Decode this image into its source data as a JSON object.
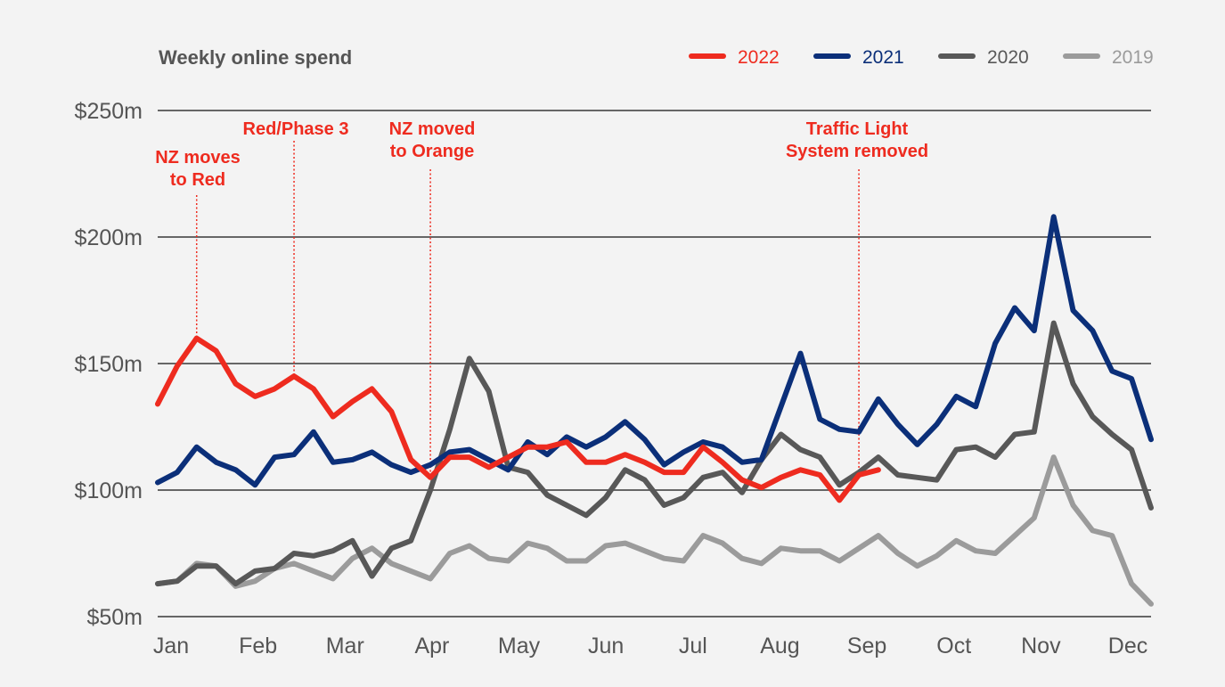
{
  "chart_data": {
    "type": "line",
    "title": "Weekly online spend",
    "xlabel": "",
    "ylabel": "",
    "ylim": [
      50,
      250
    ],
    "yticks": [
      250,
      200,
      150,
      100,
      50
    ],
    "ytick_labels": [
      "$250m",
      "$200m",
      "$150m",
      "$100m",
      "$50m"
    ],
    "grid": true,
    "x_weeks": 52,
    "x_tick_labels": [
      "Jan",
      "Feb",
      "Mar",
      "Apr",
      "May",
      "Jun",
      "Jul",
      "Aug",
      "Sep",
      "Oct",
      "Nov",
      "Dec"
    ],
    "legend_position": "top-right",
    "series": [
      {
        "name": "2019",
        "color": "#9b9b9b",
        "values": [
          63,
          64,
          71,
          70,
          62,
          64,
          69,
          71,
          68,
          65,
          73,
          77,
          71,
          68,
          65,
          75,
          78,
          73,
          72,
          79,
          77,
          72,
          72,
          78,
          79,
          76,
          73,
          72,
          82,
          79,
          73,
          71,
          77,
          76,
          76,
          72,
          77,
          82,
          75,
          70,
          74,
          80,
          76,
          75,
          82,
          89,
          113,
          94,
          84,
          82,
          63,
          55
        ]
      },
      {
        "name": "2020",
        "color": "#585858",
        "values": [
          63,
          64,
          70,
          70,
          63,
          68,
          69,
          75,
          74,
          76,
          80,
          66,
          77,
          80,
          100,
          124,
          152,
          139,
          109,
          107,
          98,
          94,
          90,
          97,
          108,
          104,
          94,
          97,
          105,
          107,
          99,
          112,
          122,
          116,
          113,
          102,
          107,
          113,
          106,
          105,
          104,
          116,
          117,
          113,
          122,
          123,
          166,
          142,
          129,
          122,
          116,
          93
        ]
      },
      {
        "name": "2021",
        "color": "#0b2f79",
        "values": [
          103,
          107,
          117,
          111,
          108,
          102,
          113,
          114,
          123,
          111,
          112,
          115,
          110,
          107,
          110,
          115,
          116,
          112,
          108,
          119,
          114,
          121,
          117,
          121,
          127,
          120,
          110,
          115,
          119,
          117,
          111,
          112,
          133,
          154,
          128,
          124,
          123,
          136,
          126,
          118,
          126,
          137,
          133,
          158,
          172,
          163,
          208,
          171,
          163,
          147,
          144,
          120
        ]
      },
      {
        "name": "2022",
        "color": "#ee2b1f",
        "values": [
          134,
          149,
          160,
          155,
          142,
          137,
          140,
          145,
          140,
          129,
          135,
          140,
          131,
          112,
          105,
          113,
          113,
          109,
          113,
          117,
          117,
          119,
          111,
          111,
          114,
          111,
          107,
          107,
          117,
          111,
          104,
          101,
          105,
          108,
          106,
          96,
          106,
          108
        ]
      }
    ],
    "annotations": [
      {
        "lines": [
          "NZ moves",
          "to Red"
        ],
        "week": 2
      },
      {
        "lines": [
          "Red/Phase 3"
        ],
        "week": 7
      },
      {
        "lines": [
          "NZ moved",
          "to Orange"
        ],
        "week": 14
      },
      {
        "lines": [
          "Traffic Light",
          "System removed"
        ],
        "week": 36
      }
    ]
  },
  "legend": [
    {
      "label": "2022",
      "color": "#ee2b1f",
      "text_color": "#ee2b1f"
    },
    {
      "label": "2021",
      "color": "#0b2f79",
      "text_color": "#0b2f79"
    },
    {
      "label": "2020",
      "color": "#585858",
      "text_color": "#585858"
    },
    {
      "label": "2019",
      "color": "#9b9b9b",
      "text_color": "#9b9b9b"
    }
  ]
}
